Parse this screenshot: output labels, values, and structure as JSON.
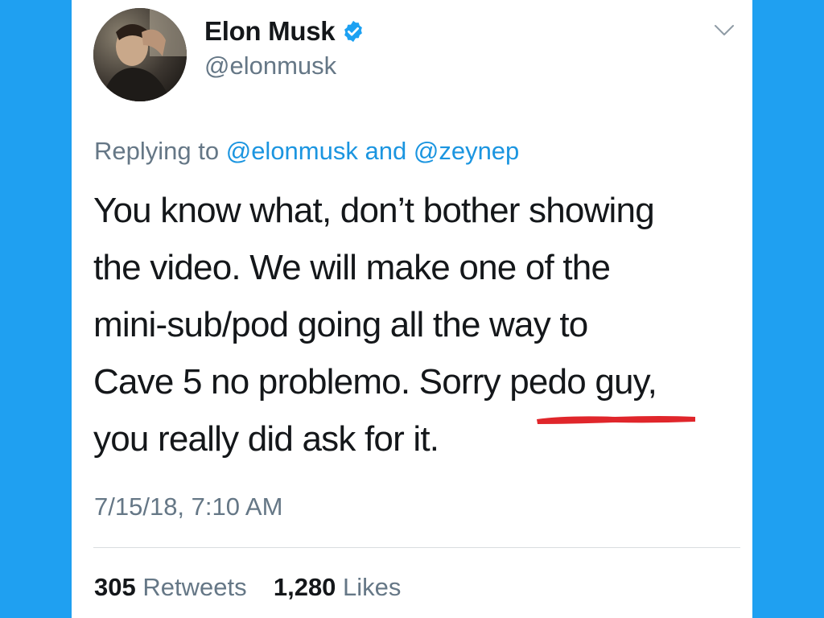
{
  "author": {
    "display_name": "Elon Musk",
    "handle": "@elonmusk",
    "verified": true,
    "avatar_icon": "profile-photo"
  },
  "reply": {
    "prefix": "Replying to",
    "mention_1": "@elonmusk",
    "conjunction": "and",
    "mention_2": "@zeynep"
  },
  "tweet": {
    "lines": [
      "You know what, don’t bother showing",
      "the video. We will make one of the",
      "mini-sub/pod going all the way to",
      "Cave 5 no problemo. Sorry pedo guy,",
      "you really did ask for it."
    ],
    "highlight_text": "pedo guy"
  },
  "timestamp": "7/15/18, 7:10 AM",
  "stats": {
    "retweets_count": "305",
    "retweets_label": "Retweets",
    "likes_count": "1,280",
    "likes_label": "Likes"
  },
  "colors": {
    "background": "#1fa0f1",
    "card": "#ffffff",
    "text_primary": "#14171a",
    "text_secondary": "#657786",
    "link": "#1b95e0",
    "verified_badge": "#1da1f2",
    "annotation_underline": "#e0262b"
  },
  "icons": {
    "verified": "verified-badge-icon",
    "menu": "chevron-down-icon"
  }
}
